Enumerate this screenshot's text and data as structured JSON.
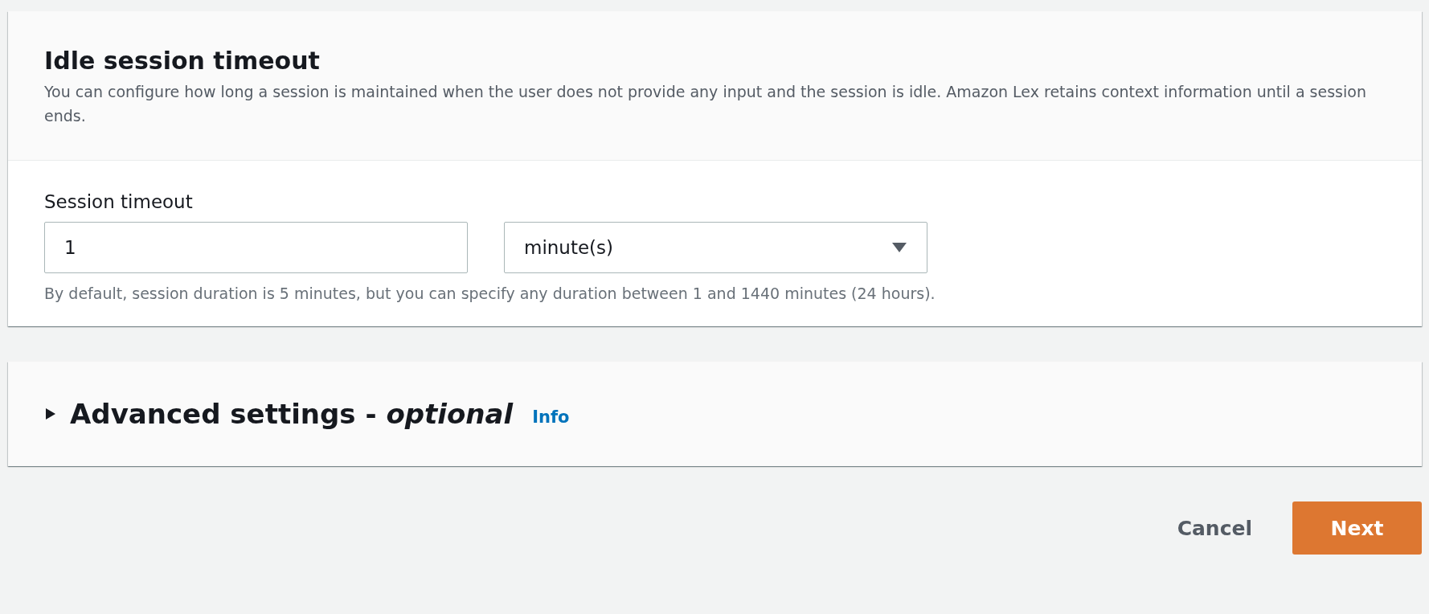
{
  "idle_session_panel": {
    "title": "Idle session timeout",
    "description": "You can configure how long a session is maintained when the user does not provide any input and the session is idle. Amazon Lex retains context information until a session ends.",
    "session_timeout": {
      "label": "Session timeout",
      "value": "1",
      "unit": "minute(s)",
      "hint": "By default, session duration is 5 minutes, but you can specify any duration between 1 and 1440 minutes (24 hours)."
    }
  },
  "advanced_settings": {
    "title": "Advanced settings - *optional*",
    "info_link": "Info",
    "expanded": false
  },
  "buttons": [
    {
      "label": "Cancel",
      "kind": "link"
    },
    {
      "label": "Next",
      "kind": "primary"
    }
  ]
}
